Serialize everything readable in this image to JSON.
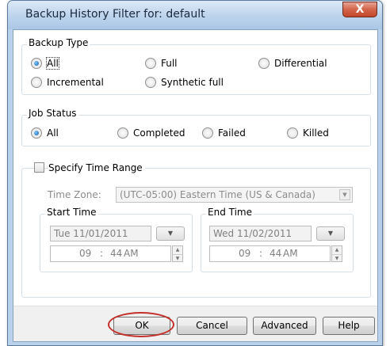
{
  "window": {
    "title": "Backup History Filter for: default",
    "close_label": "X"
  },
  "backup_type": {
    "legend": "Backup Type",
    "options": [
      {
        "label": "All",
        "selected": true
      },
      {
        "label": "Full",
        "selected": false
      },
      {
        "label": "Differential",
        "selected": false
      },
      {
        "label": "Incremental",
        "selected": false
      },
      {
        "label": "Synthetic full",
        "selected": false
      }
    ]
  },
  "job_status": {
    "legend": "Job Status",
    "options": [
      {
        "label": "All",
        "selected": true
      },
      {
        "label": "Completed",
        "selected": false
      },
      {
        "label": "Failed",
        "selected": false
      },
      {
        "label": "Killed",
        "selected": false
      }
    ]
  },
  "time_range": {
    "checkbox_label": "Specify Time Range",
    "checked": false,
    "time_zone_label": "Time Zone:",
    "time_zone_value": "(UTC-05:00) Eastern Time (US & Canada)",
    "start": {
      "legend": "Start Time",
      "date": "Tue 11/01/2011",
      "hour": "09",
      "sep": ":",
      "minute": "44",
      "ampm": "AM"
    },
    "end": {
      "legend": "End Time",
      "date": "Wed 11/02/2011",
      "hour": "09",
      "sep": ":",
      "minute": "44",
      "ampm": "AM"
    }
  },
  "buttons": {
    "ok": "OK",
    "cancel": "Cancel",
    "advanced": "Advanced",
    "help": "Help"
  },
  "colors": {
    "highlight_circle": "#c4302a",
    "radio_selected": "#0f5dae"
  },
  "icons": {
    "close": "close-icon",
    "dropdown": "chevron-down-icon",
    "spinner": "spinner-icon"
  }
}
